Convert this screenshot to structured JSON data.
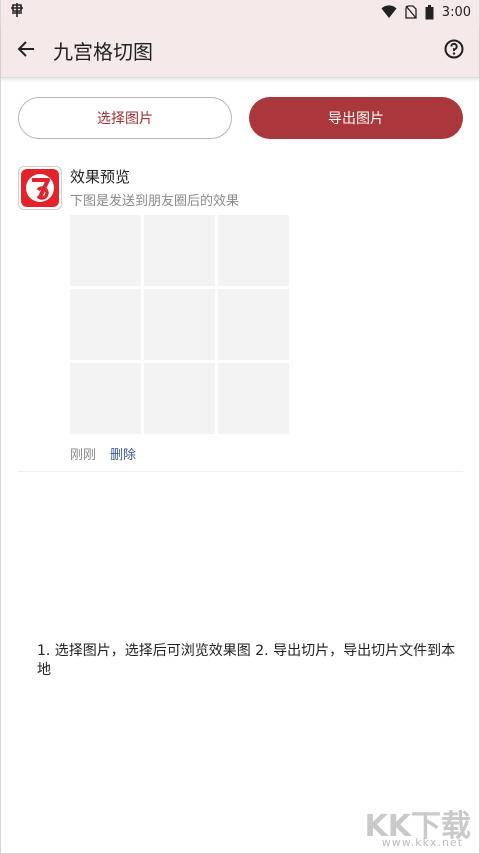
{
  "status_bar": {
    "left_icon": "bug-notification-icon",
    "time": "3:00",
    "icons": [
      "wifi-icon",
      "sim-off-icon",
      "battery-icon"
    ]
  },
  "app_bar": {
    "title": "九宫格切图",
    "back_icon": "arrow-left-icon",
    "help_icon": "help-circle-icon"
  },
  "actions": {
    "select_label": "选择图片",
    "export_label": "导出图片"
  },
  "preview": {
    "title": "效果预览",
    "subtitle": "下图是发送到朋友圈后的效果",
    "time": "刚刚",
    "delete_label": "删除",
    "grid_cells": 9
  },
  "instructions": "1. 选择图片，选择后可浏览效果图 2. 导出切片，导出切片文件到本地",
  "watermark": {
    "logo": "KK下载",
    "url": "www.kkx.net"
  },
  "colors": {
    "accent": "#a9373b",
    "appbar_bg": "#f6e9ea",
    "link": "#3c5a93",
    "logo_red": "#e3222a"
  }
}
